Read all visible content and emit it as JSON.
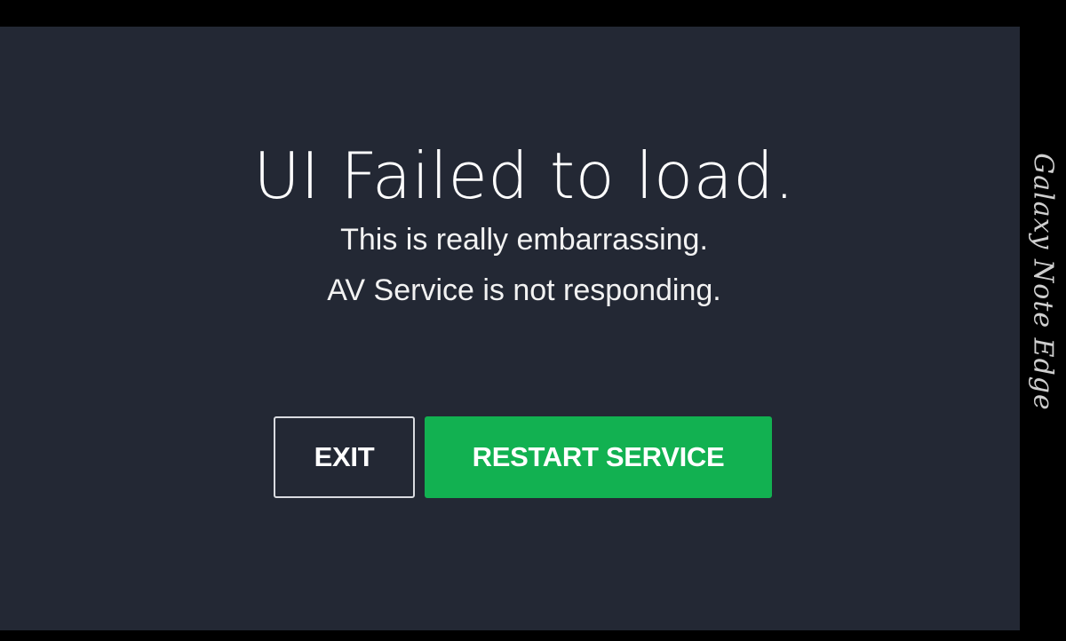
{
  "dialog": {
    "title": "UI Failed to load.",
    "message_line_1": "This is really embarrassing.",
    "message_line_2": "AV Service is not responding."
  },
  "buttons": {
    "exit_label": "EXIT",
    "restart_label": "RESTART SERVICE"
  },
  "device_watermark": "Galaxy Note Edge",
  "colors": {
    "window_background": "#232834",
    "frame": "#000000",
    "accent_green": "#12b151",
    "text": "#ffffff"
  }
}
